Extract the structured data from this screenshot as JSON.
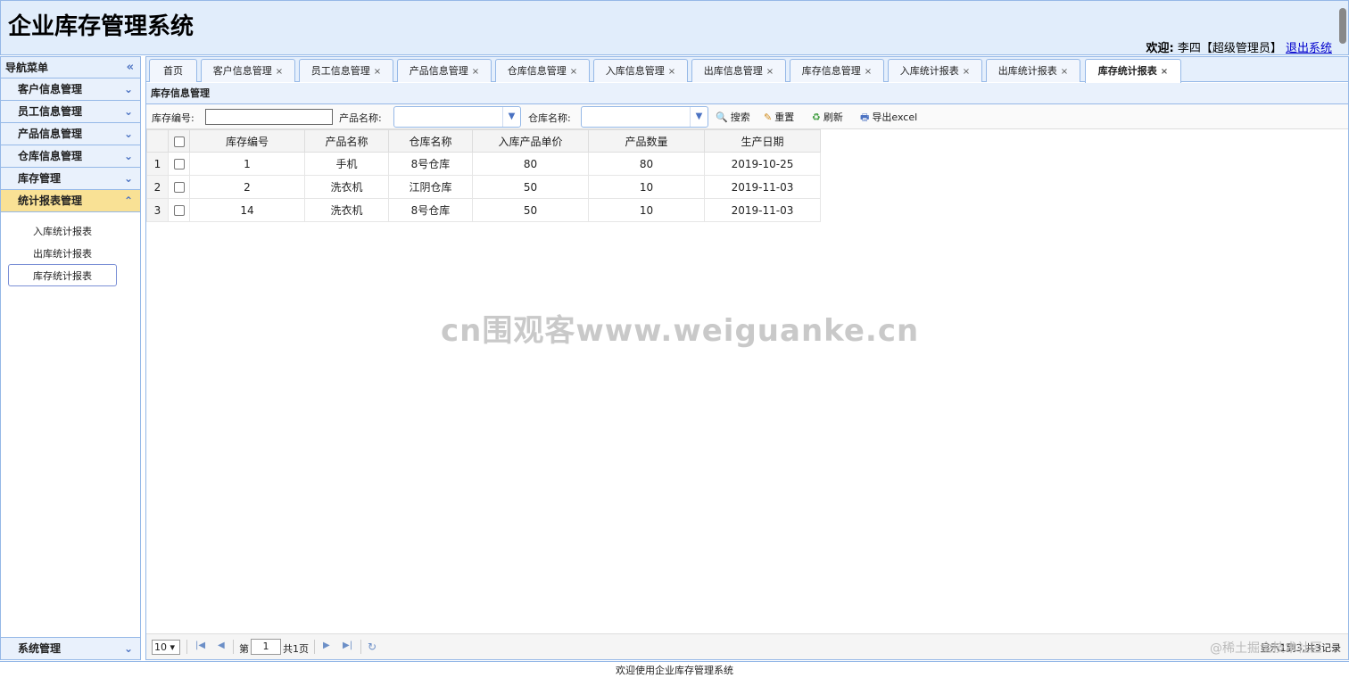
{
  "header": {
    "title": "企业库存管理系统",
    "welcome_label": "欢迎:",
    "user": "李四【超级管理员】",
    "logout": "退出系统"
  },
  "sidebar": {
    "title": "导航菜单",
    "menus": [
      {
        "label": "客户信息管理"
      },
      {
        "label": "员工信息管理"
      },
      {
        "label": "产品信息管理"
      },
      {
        "label": "仓库信息管理"
      },
      {
        "label": "库存管理"
      },
      {
        "label": "统计报表管理"
      }
    ],
    "submenu": [
      "入库统计报表",
      "出库统计报表",
      "库存统计报表"
    ],
    "bottom_menu": "系统管理"
  },
  "tabs": [
    {
      "label": "首页"
    },
    {
      "label": "客户信息管理"
    },
    {
      "label": "员工信息管理"
    },
    {
      "label": "产品信息管理"
    },
    {
      "label": "仓库信息管理"
    },
    {
      "label": "入库信息管理"
    },
    {
      "label": "出库信息管理"
    },
    {
      "label": "库存信息管理"
    },
    {
      "label": "入库统计报表"
    },
    {
      "label": "出库统计报表"
    },
    {
      "label": "库存统计报表"
    }
  ],
  "panel": {
    "title": "库存信息管理"
  },
  "search": {
    "stock_no_label": "库存编号:",
    "product_label": "产品名称:",
    "warehouse_label": "仓库名称:",
    "search_btn": "搜索",
    "reset_btn": "重置",
    "refresh_btn": "刷新",
    "export_btn": "导出excel"
  },
  "table": {
    "columns": [
      "库存编号",
      "产品名称",
      "仓库名称",
      "入库产品单价",
      "产品数量",
      "生产日期"
    ],
    "rows": [
      [
        "1",
        "1",
        "手机",
        "8号仓库",
        "80",
        "80",
        "2019-10-25"
      ],
      [
        "2",
        "2",
        "洗衣机",
        "江阴仓库",
        "50",
        "10",
        "2019-11-03"
      ],
      [
        "3",
        "14",
        "洗衣机",
        "8号仓库",
        "50",
        "10",
        "2019-11-03"
      ]
    ]
  },
  "pager": {
    "page_size": "10",
    "page_prefix": "第",
    "page_value": "1",
    "page_total": "共1页",
    "info": "显示1到3,共3记录"
  },
  "watermark": "cn围观客www.weiguanke.cn",
  "watermark2": "@稀土掘金技术社区",
  "footer": "欢迎使用企业库存管理系统"
}
